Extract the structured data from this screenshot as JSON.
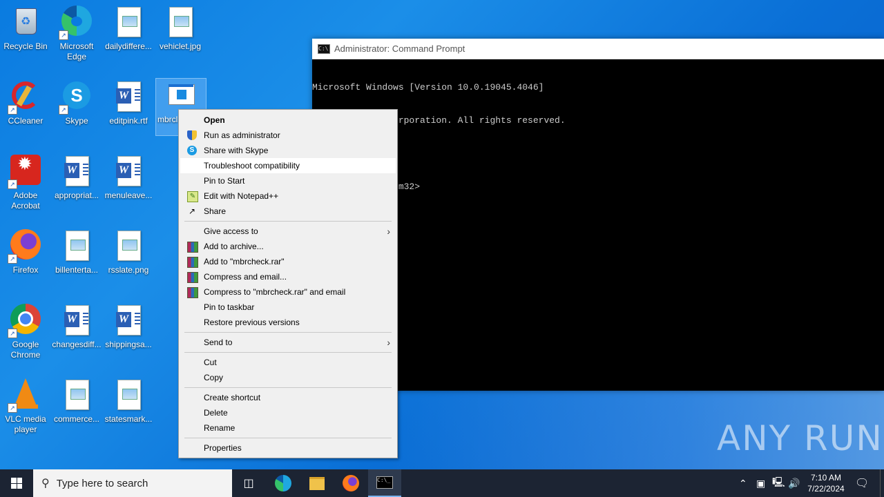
{
  "desktop_icons": [
    {
      "label": "Recycle Bin"
    },
    {
      "label": "Microsoft Edge"
    },
    {
      "label": "dailydiffere..."
    },
    {
      "label": "vehiclet.jpg"
    },
    {
      "label": "CCleaner"
    },
    {
      "label": "Skype"
    },
    {
      "label": "editpink.rtf"
    },
    {
      "label": "mbrcl"
    },
    {
      "label": "Adobe Acrobat"
    },
    {
      "label": "appropriat..."
    },
    {
      "label": "menuleave..."
    },
    {
      "label": "Firefox"
    },
    {
      "label": "billenterta..."
    },
    {
      "label": "rsslate.png"
    },
    {
      "label": "Google Chrome"
    },
    {
      "label": "changesdiff..."
    },
    {
      "label": "shippingsa..."
    },
    {
      "label": "VLC media player"
    },
    {
      "label": "commerce..."
    },
    {
      "label": "statesmark..."
    }
  ],
  "cmd": {
    "title": "Administrator: Command Prompt",
    "lines": [
      "Microsoft Windows [Version 10.0.19045.4046]",
      "(c) Microsoft Corporation. All rights reserved.",
      "",
      "C:\\WINDOWS\\system32>"
    ]
  },
  "context_menu": {
    "items": [
      {
        "label": "Open"
      },
      {
        "label": "Run as administrator"
      },
      {
        "label": "Share with Skype"
      },
      {
        "label": "Troubleshoot compatibility"
      },
      {
        "label": "Pin to Start"
      },
      {
        "label": "Edit with Notepad++"
      },
      {
        "label": "Share"
      },
      {
        "label": "Give access to"
      },
      {
        "label": "Add to archive..."
      },
      {
        "label": "Add to \"mbrcheck.rar\""
      },
      {
        "label": "Compress and email..."
      },
      {
        "label": "Compress to \"mbrcheck.rar\" and email"
      },
      {
        "label": "Pin to taskbar"
      },
      {
        "label": "Restore previous versions"
      },
      {
        "label": "Send to"
      },
      {
        "label": "Cut"
      },
      {
        "label": "Copy"
      },
      {
        "label": "Create shortcut"
      },
      {
        "label": "Delete"
      },
      {
        "label": "Rename"
      },
      {
        "label": "Properties"
      }
    ]
  },
  "taskbar": {
    "search_placeholder": "Type here to search",
    "time": "7:10 AM",
    "date": "7/22/2024"
  },
  "watermark": "ANY RUN"
}
